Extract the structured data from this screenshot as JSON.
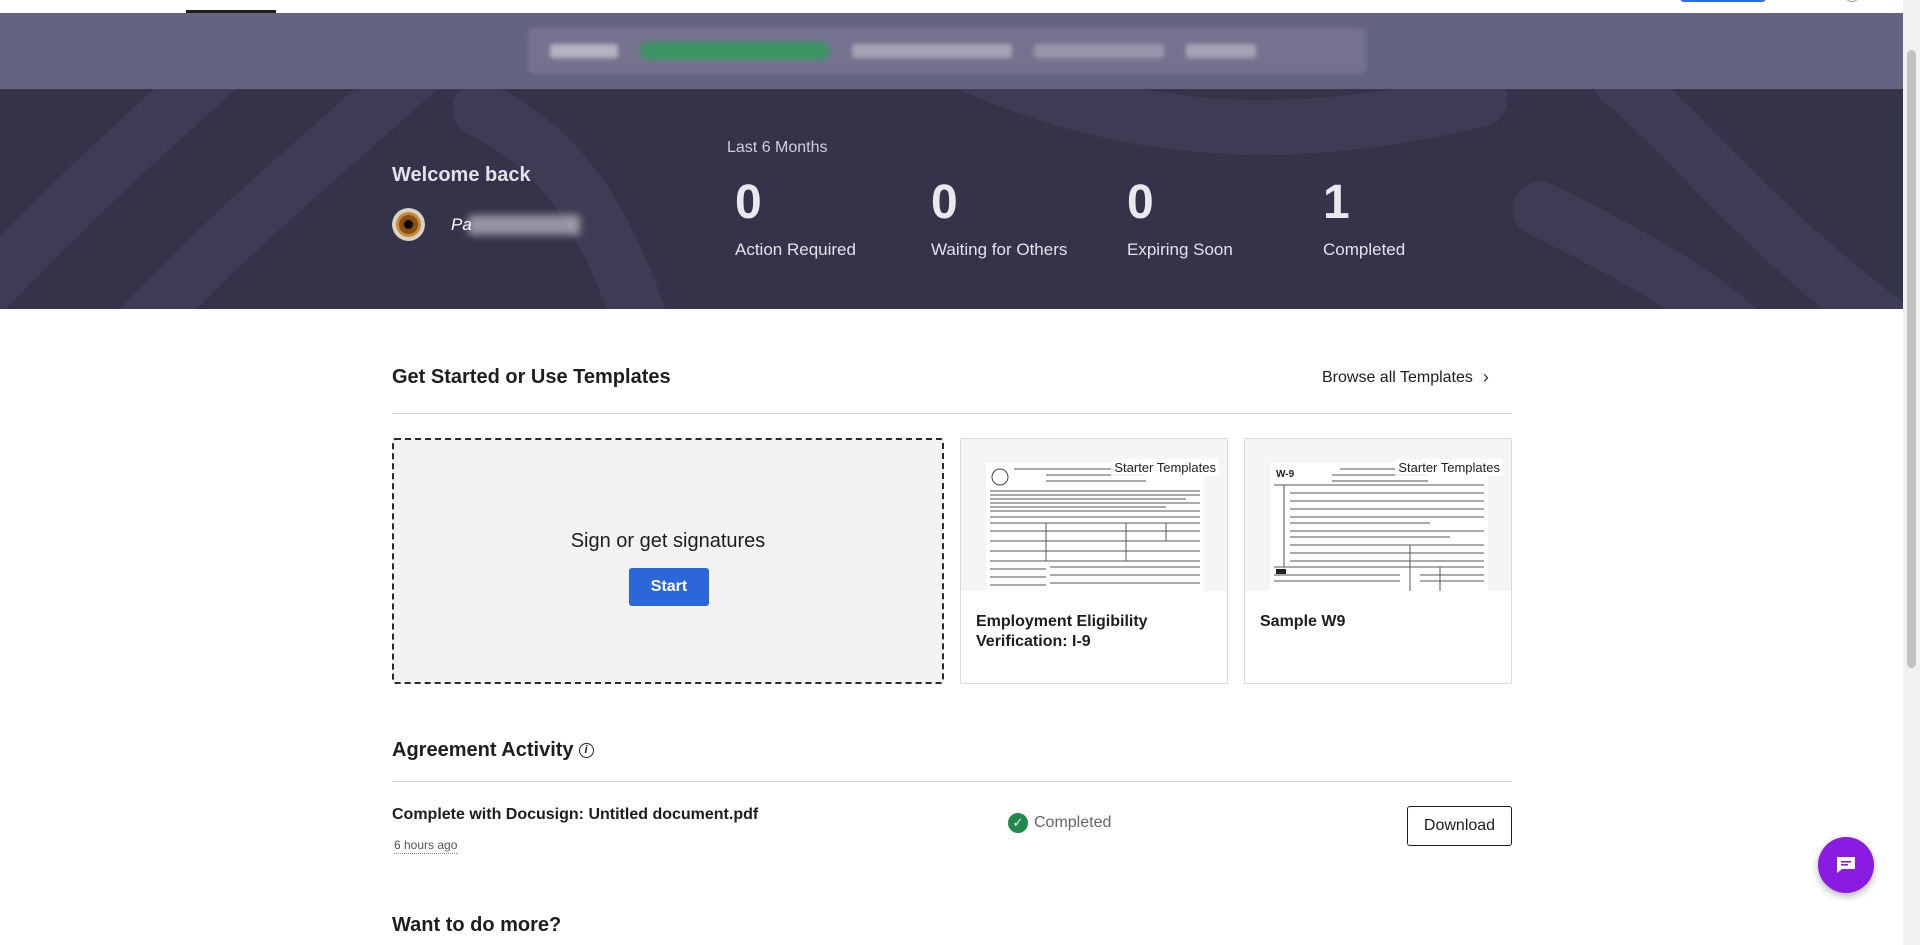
{
  "hero": {
    "welcome": "Welcome back",
    "user_name_visible": "Pa",
    "period": "Last 6 Months",
    "stats": [
      {
        "value": "0",
        "label": "Action Required"
      },
      {
        "value": "0",
        "label": "Waiting for Others"
      },
      {
        "value": "0",
        "label": "Expiring Soon"
      },
      {
        "value": "1",
        "label": "Completed"
      }
    ]
  },
  "templates": {
    "title": "Get Started or Use Templates",
    "browse_label": "Browse all Templates",
    "dropzone_title": "Sign or get signatures",
    "start_label": "Start",
    "cards": [
      {
        "badge": "Starter Templates",
        "name": "Employment Eligibility Verification: I-9"
      },
      {
        "badge": "Starter Templates",
        "name": "Sample W9"
      }
    ]
  },
  "activity": {
    "title": "Agreement Activity",
    "items": [
      {
        "name": "Complete with Docusign: Untitled document.pdf",
        "time": "6 hours ago",
        "status": "Completed",
        "action_label": "Download"
      }
    ]
  },
  "more": {
    "title": "Want to do more?"
  },
  "colors": {
    "hero_bg": "#35334a",
    "banner_bg": "#656382",
    "primary_button": "#2b67d9",
    "status_completed": "#1f8a4c",
    "chat_fab": "#8a1be2"
  },
  "icons": {
    "browse": "chevron-right-icon",
    "info": "info-icon",
    "status": "check-circle-icon",
    "chat": "chat-bubble-icon"
  }
}
